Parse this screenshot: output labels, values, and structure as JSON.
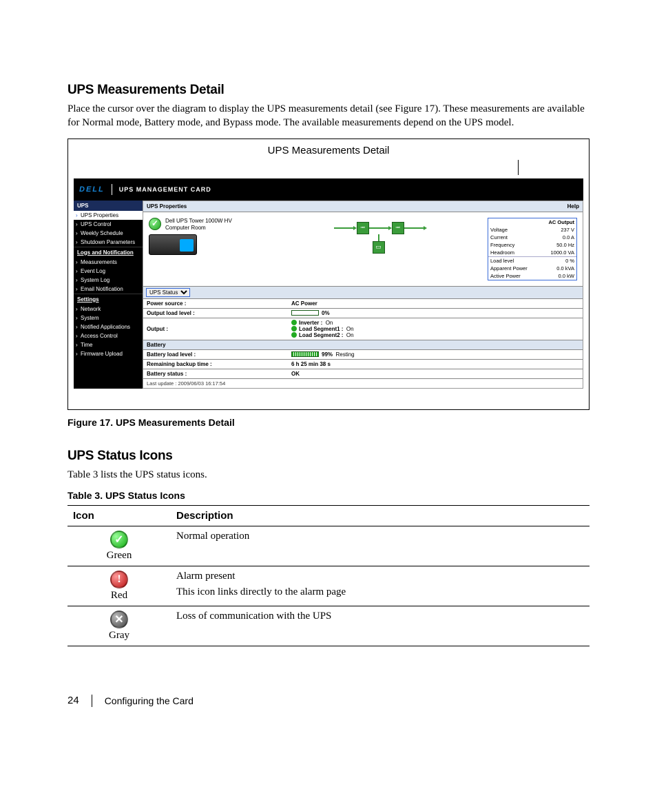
{
  "section1": {
    "heading": "UPS Measurements Detail",
    "text": "Place the cursor over the diagram to display the UPS measurements detail (see Figure 17). These measurements are available for Normal mode, Battery mode, and Bypass mode. The available measurements depend on the UPS model."
  },
  "callout": "UPS Measurements Detail",
  "app": {
    "logo": "DELL",
    "title": "UPS MANAGEMENT CARD",
    "nav": {
      "h1": "UPS",
      "i1": "UPS Properties",
      "i2": "UPS Control",
      "i3": "Weekly Schedule",
      "i4": "Shutdown Parameters",
      "s1": "Logs and Notification",
      "i5": "Measurements",
      "i6": "Event Log",
      "i7": "System Log",
      "i8": "Email Notification",
      "s2": "Settings",
      "i9": "Network",
      "i10": "System",
      "i11": "Notified Applications",
      "i12": "Access Control",
      "i13": "Time",
      "i14": "Firmware Upload"
    },
    "content": {
      "header": "UPS Properties",
      "help": "Help",
      "ident1": "Dell UPS Tower 1000W HV",
      "ident2": "Computer Room",
      "meas": {
        "h": "AC Output",
        "r1a": "Voltage",
        "r1b": "237 V",
        "r2a": "Current",
        "r2b": "0.0 A",
        "r3a": "Frequency",
        "r3b": "50.0 Hz",
        "r4a": "Headroom",
        "r4b": "1000.0 VA",
        "r5a": "Load level",
        "r5b": "0 %",
        "r6a": "Apparent Power",
        "r6b": "0.0 kVA",
        "r7a": "Active Power",
        "r7b": "0.0 kW"
      },
      "status_select": "UPS Status",
      "rows": {
        "r1l": "Power source :",
        "r1v": "AC Power",
        "r2l": "Output load level :",
        "r2v": "0%",
        "r3l": "Output :",
        "r3a": "Inverter :",
        "r3av": "On",
        "r3b": "Load Segment1 :",
        "r3bv": "On",
        "r3c": "Load Segment2 :",
        "r3cv": "On",
        "sec2": "Battery",
        "r4l": "Battery load level :",
        "r4v": "99%",
        "r4s": "Resting",
        "r5l": "Remaining backup time :",
        "r5v": "6 h 25 min 38 s",
        "r6l": "Battery status :",
        "r6v": "OK",
        "foot": "Last update : 2009/06/03 16:17:54"
      }
    }
  },
  "figcap": "Figure 17. UPS Measurements Detail",
  "section2": {
    "heading": "UPS Status Icons",
    "text": "Table 3 lists the UPS status icons."
  },
  "tblcap": "Table 3. UPS Status Icons",
  "table": {
    "h1": "Icon",
    "h2": "Description",
    "r1lbl": "Green",
    "r1desc": "Normal operation",
    "r2lbl": "Red",
    "r2desc1": "Alarm present",
    "r2desc2": "This icon links directly to the alarm page",
    "r3lbl": "Gray",
    "r3desc": "Loss of communication with the UPS"
  },
  "footer": {
    "page": "24",
    "chapter": "Configuring the Card"
  }
}
